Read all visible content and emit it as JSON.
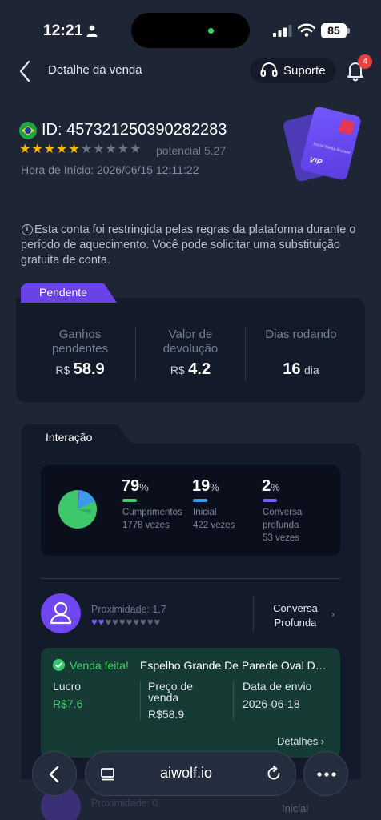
{
  "status_bar": {
    "time": "12:21",
    "battery": "85"
  },
  "header": {
    "title": "Detalhe da venda",
    "support_label": "Suporte",
    "notification_count": "4"
  },
  "account": {
    "id": "ID: 457321250390282283",
    "rating_stars": 5,
    "rating_max": 10,
    "potential": "potencial 5.27",
    "start_time": "Hora de Início: 2026/06/15 12:11:22",
    "card_text": "Social Media Account",
    "card_badge": "VIP"
  },
  "notice": "Esta conta foi restringida pelas regras da plataforma durante o período de aquecimento. Você pode solicitar uma substituição gratuita de conta.",
  "pending": {
    "tab": "Pendente",
    "stats": [
      {
        "label": "Ganhos pendentes",
        "currency": "R$",
        "value": "58.9",
        "unit": ""
      },
      {
        "label": "Valor de devolução",
        "currency": "R$",
        "value": "4.2",
        "unit": ""
      },
      {
        "label": "Dias rodando",
        "currency": "",
        "value": "16",
        "unit": "dia"
      }
    ]
  },
  "interaction": {
    "tab": "Interação",
    "stats": [
      {
        "pct": "79",
        "pct_sign": "%",
        "label": "Cumprimentos",
        "count": "1778 vezes",
        "color": "#3fc86a"
      },
      {
        "pct": "19",
        "pct_sign": "%",
        "label": "Inicial",
        "count": "422 vezes",
        "color": "#3d9ae6"
      },
      {
        "pct": "2",
        "pct_sign": "%",
        "label": "Conversa profunda",
        "count": "53 vezes",
        "color": "#7b5cff"
      }
    ],
    "contact": {
      "proximity": "Proximidade: 1.7",
      "hearts_filled": 2,
      "hearts_total": 10,
      "stage": "Conversa Profunda"
    },
    "sale": {
      "status": "Venda feita!",
      "product": "Espelho Grande De Parede Oval Decorativo",
      "profit_label": "Lucro",
      "profit_value": "R$7.6",
      "price_label": "Preço de venda",
      "price_value": "R$58.9",
      "date_label": "Data de envio",
      "date_value": "2026-06-18",
      "details": "Detalhes ›"
    },
    "next_contact": {
      "proximity": "Proximidade: 0",
      "stage": "Inicial"
    }
  },
  "browser": {
    "url": "aiwolf.io"
  },
  "colors": {
    "accent": "#6a43e8",
    "success": "#3fd071",
    "background": "#1e2535"
  }
}
